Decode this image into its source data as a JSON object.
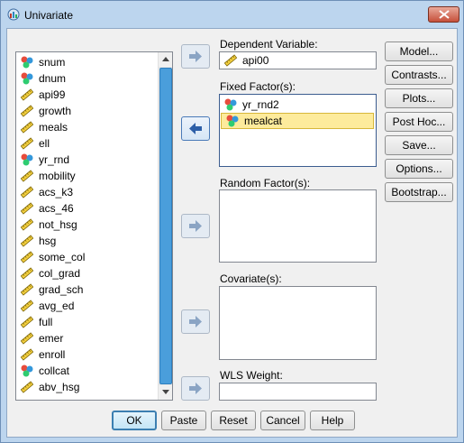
{
  "window": {
    "title": "Univariate"
  },
  "variables": [
    {
      "label": "snum",
      "icon": "nominal-icon"
    },
    {
      "label": "dnum",
      "icon": "nominal-icon"
    },
    {
      "label": "api99",
      "icon": "scale-ruler-icon"
    },
    {
      "label": "growth",
      "icon": "scale-ruler-icon"
    },
    {
      "label": "meals",
      "icon": "scale-ruler-icon"
    },
    {
      "label": "ell",
      "icon": "scale-ruler-icon"
    },
    {
      "label": "yr_rnd",
      "icon": "nominal-icon"
    },
    {
      "label": "mobility",
      "icon": "scale-ruler-icon"
    },
    {
      "label": "acs_k3",
      "icon": "scale-ruler-icon"
    },
    {
      "label": "acs_46",
      "icon": "scale-ruler-icon"
    },
    {
      "label": "not_hsg",
      "icon": "scale-ruler-icon"
    },
    {
      "label": "hsg",
      "icon": "scale-ruler-icon"
    },
    {
      "label": "some_col",
      "icon": "scale-ruler-icon"
    },
    {
      "label": "col_grad",
      "icon": "scale-ruler-icon"
    },
    {
      "label": "grad_sch",
      "icon": "scale-ruler-icon"
    },
    {
      "label": "avg_ed",
      "icon": "scale-ruler-icon"
    },
    {
      "label": "full",
      "icon": "scale-ruler-icon"
    },
    {
      "label": "emer",
      "icon": "scale-ruler-icon"
    },
    {
      "label": "enroll",
      "icon": "scale-ruler-icon"
    },
    {
      "label": "collcat",
      "icon": "nominal-icon"
    },
    {
      "label": "abv_hsg",
      "icon": "scale-ruler-icon"
    }
  ],
  "dependent": {
    "label": "Dependent Variable:",
    "value": "api00"
  },
  "fixed": {
    "label": "Fixed Factor(s):",
    "items": [
      "yr_rnd2",
      "mealcat"
    ]
  },
  "random": {
    "label": "Random Factor(s):"
  },
  "covariate": {
    "label": "Covariate(s):"
  },
  "wls": {
    "label": "WLS Weight:"
  },
  "side_buttons": [
    "Model...",
    "Contrasts...",
    "Plots...",
    "Post Hoc...",
    "Save...",
    "Options...",
    "Bootstrap..."
  ],
  "bottom_buttons": [
    "OK",
    "Paste",
    "Reset",
    "Cancel",
    "Help"
  ],
  "colors": {
    "selection": "#fdeb9c",
    "scroll_thumb": "#4a9edb",
    "title_bar": "#bcd5ee"
  }
}
